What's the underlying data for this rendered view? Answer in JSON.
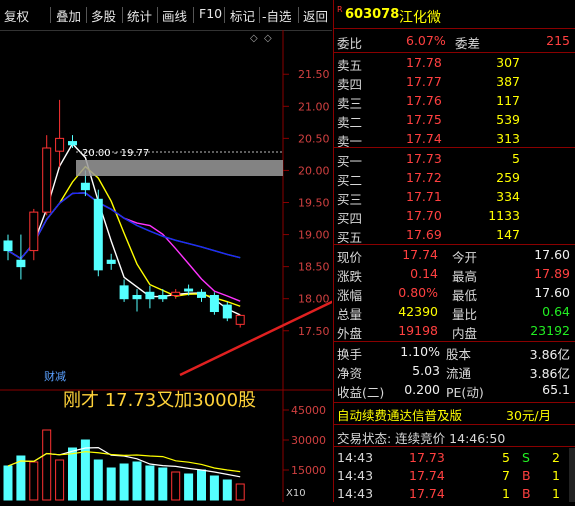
{
  "toolbar": {
    "items": [
      "复权",
      "叠加",
      "多股",
      "统计",
      "画线",
      "F10",
      "标记",
      "-自选",
      "返回"
    ]
  },
  "chart": {
    "price_axis": [
      "21.50",
      "21.00",
      "20.50",
      "20.00",
      "19.50",
      "19.00",
      "18.50",
      "18.00",
      "17.50"
    ],
    "range_label": "20.00 - 19.77",
    "event_label": "财减",
    "volume_axis": [
      "45000",
      "30000",
      "15000"
    ],
    "volume_multiplier": "X10",
    "annotation": "刚才 17.73又加3000股",
    "chart_data": {
      "type": "candlestick",
      "ylim": [
        17.2,
        21.8
      ],
      "candles": [
        {
          "o": 18.9,
          "h": 19.0,
          "l": 18.6,
          "c": 18.75,
          "up": false
        },
        {
          "o": 18.6,
          "h": 19.0,
          "l": 18.3,
          "c": 18.5,
          "up": false
        },
        {
          "o": 18.75,
          "h": 19.4,
          "l": 18.6,
          "c": 19.35,
          "up": true
        },
        {
          "o": 19.35,
          "h": 20.55,
          "l": 19.3,
          "c": 20.35,
          "up": true
        },
        {
          "o": 20.3,
          "h": 21.1,
          "l": 20.05,
          "c": 20.5,
          "up": true
        },
        {
          "o": 20.45,
          "h": 20.55,
          "l": 20.35,
          "c": 20.4,
          "up": false
        },
        {
          "o": 19.8,
          "h": 20.0,
          "l": 19.6,
          "c": 19.7,
          "up": false
        },
        {
          "o": 19.55,
          "h": 19.7,
          "l": 18.35,
          "c": 18.45,
          "up": false
        },
        {
          "o": 18.6,
          "h": 18.7,
          "l": 18.45,
          "c": 18.55,
          "up": false
        },
        {
          "o": 18.2,
          "h": 18.3,
          "l": 17.95,
          "c": 18.0,
          "up": false
        },
        {
          "o": 18.05,
          "h": 18.15,
          "l": 17.8,
          "c": 18.0,
          "up": false
        },
        {
          "o": 18.0,
          "h": 18.2,
          "l": 17.85,
          "c": 18.1,
          "up": false
        },
        {
          "o": 18.05,
          "h": 18.15,
          "l": 17.95,
          "c": 18.0,
          "up": false
        },
        {
          "o": 18.05,
          "h": 18.15,
          "l": 18.0,
          "c": 18.1,
          "up": true
        },
        {
          "o": 18.12,
          "h": 18.22,
          "l": 18.05,
          "c": 18.15,
          "up": false
        },
        {
          "o": 18.1,
          "h": 18.15,
          "l": 17.95,
          "c": 18.02,
          "up": false
        },
        {
          "o": 18.05,
          "h": 18.1,
          "l": 17.75,
          "c": 17.8,
          "up": false
        },
        {
          "o": 17.9,
          "h": 17.95,
          "l": 17.65,
          "c": 17.7,
          "up": false
        },
        {
          "o": 17.6,
          "h": 17.75,
          "l": 17.55,
          "c": 17.74,
          "up": true
        }
      ],
      "volumes": [
        17,
        22,
        19,
        35,
        20,
        26,
        30,
        20,
        16,
        18,
        19,
        17,
        16,
        14,
        13,
        15,
        12,
        10,
        8
      ],
      "volume_ylim": [
        0,
        50
      ]
    }
  },
  "quote": {
    "code_mark": "R",
    "code": "603078",
    "name": "江化微",
    "weibi_label": "委比",
    "weibi": "6.07%",
    "weicha_label": "委差",
    "weicha": "215",
    "asks": [
      {
        "label": "卖五",
        "price": "17.78",
        "vol": "307"
      },
      {
        "label": "卖四",
        "price": "17.77",
        "vol": "387"
      },
      {
        "label": "卖三",
        "price": "17.76",
        "vol": "117"
      },
      {
        "label": "卖二",
        "price": "17.75",
        "vol": "539"
      },
      {
        "label": "卖一",
        "price": "17.74",
        "vol": "313"
      }
    ],
    "bids": [
      {
        "label": "买一",
        "price": "17.73",
        "vol": "5"
      },
      {
        "label": "买二",
        "price": "17.72",
        "vol": "259"
      },
      {
        "label": "买三",
        "price": "17.71",
        "vol": "334"
      },
      {
        "label": "买四",
        "price": "17.70",
        "vol": "1133"
      },
      {
        "label": "买五",
        "price": "17.69",
        "vol": "147"
      }
    ],
    "stats": [
      {
        "l1": "现价",
        "v1": "17.74",
        "l2": "今开",
        "v2": "17.60"
      },
      {
        "l1": "涨跌",
        "v1": "0.14",
        "l2": "最高",
        "v2": "17.89"
      },
      {
        "l1": "涨幅",
        "v1": "0.80%",
        "l2": "最低",
        "v2": "17.60"
      },
      {
        "l1": "总量",
        "v1": "42390",
        "l2": "量比",
        "v2": "0.64"
      },
      {
        "l1": "外盘",
        "v1": "19198",
        "l2": "内盘",
        "v2": "23192"
      }
    ],
    "fin": [
      {
        "l1": "换手",
        "v1": "1.10%",
        "l2": "股本",
        "v2": "3.86亿"
      },
      {
        "l1": "净资",
        "v1": "5.03",
        "l2": "流通",
        "v2": "3.86亿"
      },
      {
        "l1": "收益(二)",
        "v1": "0.200",
        "l2": "PE(动)",
        "v2": "65.1"
      }
    ],
    "promo": "自动续费通达信普及版",
    "promo_price": "30元/月",
    "status": "交易状态: 连续竞价 14:46:50",
    "ticks": [
      {
        "time": "14:43",
        "price": "17.73",
        "vol": "5",
        "side": "S"
      },
      {
        "time": "14:43",
        "price": "17.74",
        "vol": "7",
        "side": "B"
      },
      {
        "time": "14:43",
        "price": "17.74",
        "vol": "1",
        "side": "B"
      }
    ],
    "tick_extra": [
      "2",
      "1",
      "1"
    ]
  }
}
